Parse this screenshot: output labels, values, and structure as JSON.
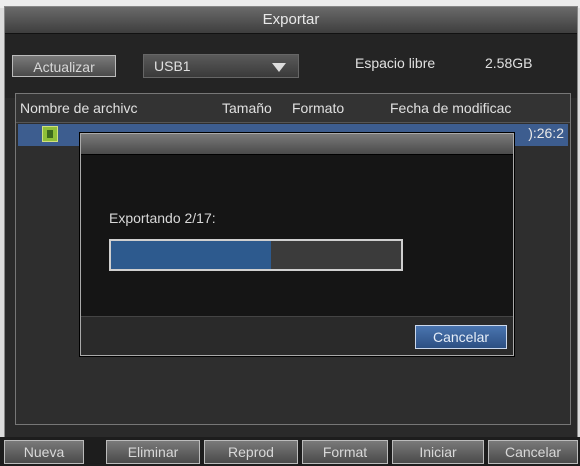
{
  "window": {
    "title": "Exportar"
  },
  "toolbar": {
    "refresh_label": "Actualizar",
    "device": "USB1",
    "free_space_label": "Espacio libre",
    "free_space_value": "2.58GB"
  },
  "table": {
    "columns": [
      "Nombre de archivc",
      "Tamaño",
      "Formato",
      "Fecha de modificac"
    ],
    "selected_row": {
      "time_fragment": "):26:2"
    }
  },
  "dialog": {
    "message": "Exportando 2/17:",
    "progress": 0.55,
    "cancel_label": "Cancelar"
  },
  "bottom_buttons": [
    "Nueva",
    "Eliminar",
    "Reprod",
    "Format",
    "Iniciar",
    "Cancelar"
  ],
  "colors": {
    "accent": "#3d5d8f",
    "progress": "#2d5a8e"
  }
}
